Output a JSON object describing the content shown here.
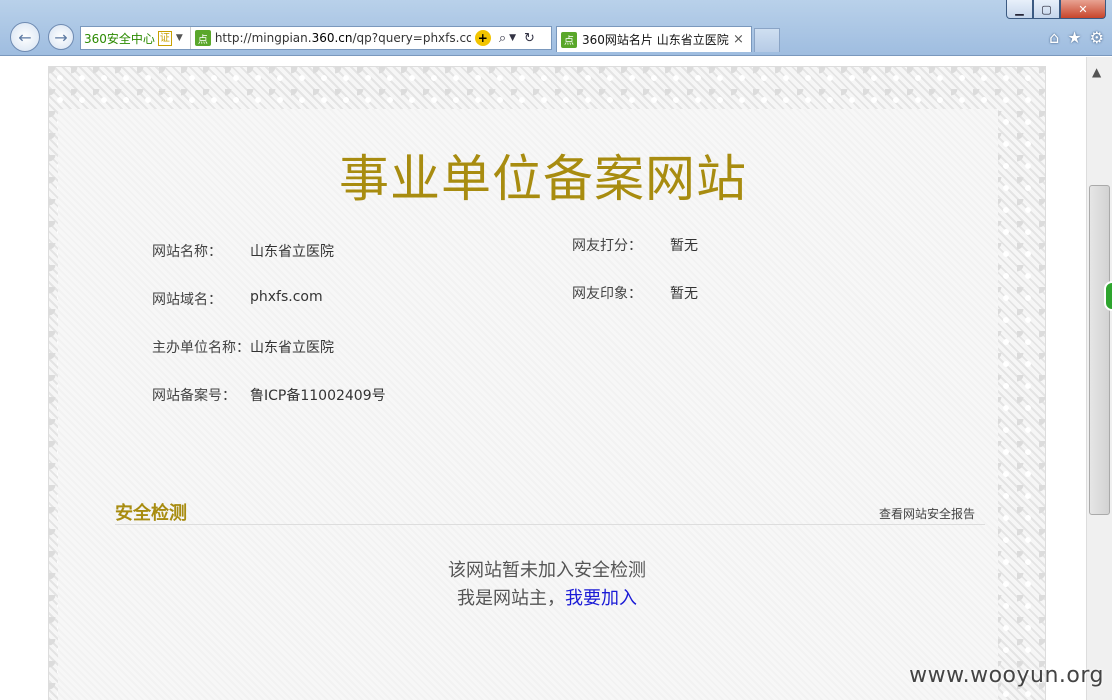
{
  "browser": {
    "zone_label": "360安全中心",
    "cert_label": "证",
    "url_prefix": "http://mingpian.",
    "url_domain": "360.cn",
    "url_suffix": "/qp?query=phxfs.com",
    "site_icon_glyph": "点",
    "tab_title": "360网站名片 山东省立医院",
    "tab_close": "×"
  },
  "page": {
    "title": "事业单位备案网站",
    "fields_left": [
      {
        "label": "网站名称：",
        "value": "山东省立医院"
      },
      {
        "label": "网站域名：",
        "value": "phxfs.com"
      },
      {
        "label": "主办单位名称：",
        "value": "山东省立医院"
      },
      {
        "label": "网站备案号：",
        "value": "鲁ICP备11002409号"
      }
    ],
    "fields_right": [
      {
        "label": "网友打分：",
        "value": "暂无"
      },
      {
        "label": "网友印象：",
        "value": "暂无"
      }
    ],
    "security": {
      "title": "安全检测",
      "report_link": "查看网站安全报告",
      "message": "该网站暂未加入安全检测",
      "owner_prefix": "我是网站主，",
      "join_link": "我要加入"
    }
  },
  "watermark": "www.wooyun.org",
  "colors": {
    "accent_gold": "#a88c10",
    "link_blue": "#1b1bd6"
  }
}
